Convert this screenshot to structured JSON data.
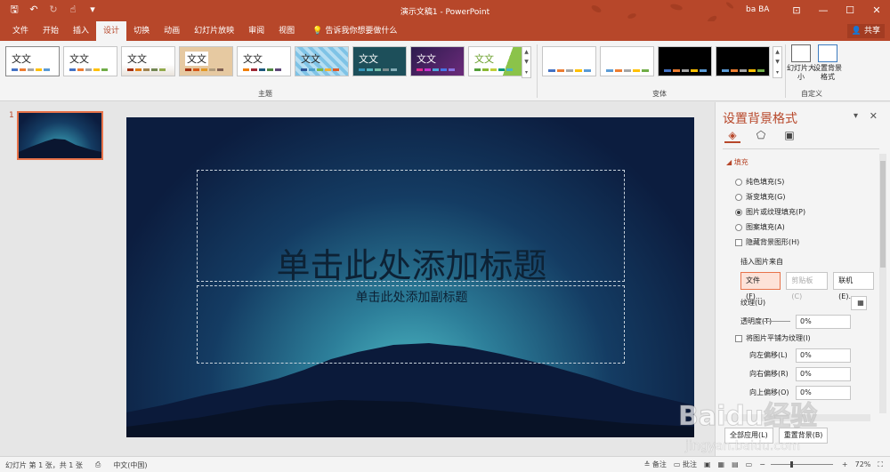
{
  "window": {
    "title": "演示文稿1 - PowerPoint",
    "user": "ba BA"
  },
  "tabs": [
    "文件",
    "开始",
    "插入",
    "设计",
    "切换",
    "动画",
    "幻灯片放映",
    "审阅",
    "视图"
  ],
  "tell_me": "告诉我你想要做什么",
  "share": "共享",
  "ribbon": {
    "theme_text": "文文",
    "themes_group": "主题",
    "variants_group": "变体",
    "customize_group": "自定义",
    "slide_size": "幻灯片大小",
    "format_bg": "设置背景格式"
  },
  "thumbnail": {
    "number": "1"
  },
  "slide": {
    "title_placeholder": "单击此处添加标题",
    "subtitle_placeholder": "单击此处添加副标题"
  },
  "format_pane": {
    "title": "设置背景格式",
    "section_fill": "填充",
    "options": [
      "纯色填充(S)",
      "渐变填充(G)",
      "图片或纹理填充(P)",
      "图案填充(A)"
    ],
    "selected_option": "图片或纹理填充(P)",
    "hide_bg": "隐藏背景图形(H)",
    "insert_from": "插入图片来自",
    "btn_file": "文件(F)...",
    "btn_clipboard": "剪贴板(C)",
    "btn_online": "联机(E)...",
    "texture": "纹理(U)",
    "transparency": "透明度(T)",
    "transparency_val": "0%",
    "tile": "将图片平铺为纹理(I)",
    "offset_left": "向左偏移(L)",
    "offset_left_val": "0%",
    "offset_right": "向右偏移(R)",
    "offset_right_val": "0%",
    "offset_top": "向上偏移(O)",
    "offset_top_val": "0%",
    "apply_all": "全部应用(L)",
    "reset_bg": "重置背景(B)"
  },
  "status": {
    "slide_info": "幻灯片 第 1 张，共 1 张",
    "language": "中文(中国)",
    "notes": "备注",
    "comments": "批注",
    "zoom": "72%"
  },
  "watermark": {
    "text": "Baidu经验",
    "sub": "jingyan.baidu.com"
  },
  "colors": {
    "accent": "#b7472a",
    "ribbon": "#f4f4f4"
  }
}
